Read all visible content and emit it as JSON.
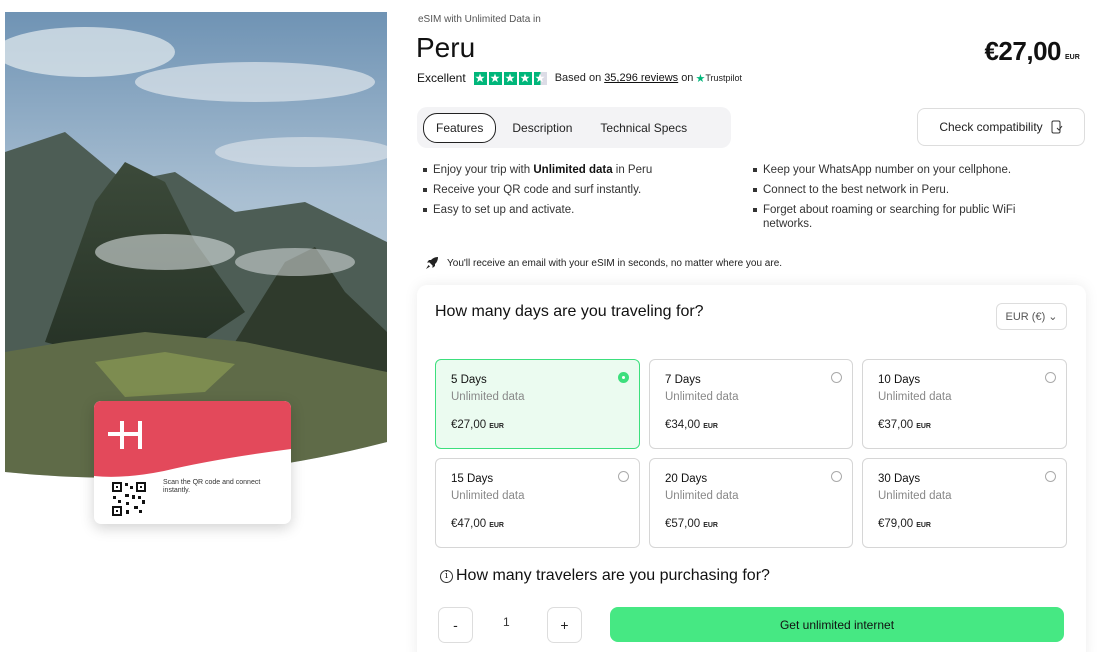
{
  "hero": {
    "card_text": "Scan the QR code and connect instantly."
  },
  "header": {
    "subtitle": "eSIM with Unlimited Data in",
    "title": "Peru",
    "price": "€27,00",
    "price_currency": "EUR"
  },
  "rating": {
    "label": "Excellent",
    "stars": 4.5,
    "based_on": "Based on",
    "reviews": "35,296 reviews",
    "on": "on",
    "provider": "Trustpilot"
  },
  "tabs": [
    {
      "label": "Features",
      "active": true
    },
    {
      "label": "Description",
      "active": false
    },
    {
      "label": "Technical Specs",
      "active": false
    }
  ],
  "compat_button": "Check compatibility",
  "features_left": {
    "f1_pre": "Enjoy your trip with ",
    "f1_bold": "Unlimited data",
    "f1_post": " in Peru",
    "f2": "Receive your QR code and surf instantly.",
    "f3": "Easy to set up and activate."
  },
  "features_right": {
    "f1": "Keep your WhatsApp number on your cellphone.",
    "f2": "Connect to the best network in Peru.",
    "f3": "Forget about roaming or searching for public WiFi networks."
  },
  "email_note": "You'll receive an email with your eSIM in seconds, no matter where you are.",
  "plan_question": "How many days are you traveling for?",
  "currency_select": "EUR (€)",
  "plans": [
    {
      "days": "5 Days",
      "data": "Unlimited data",
      "price": "€27,00",
      "cur": "EUR",
      "selected": true
    },
    {
      "days": "7 Days",
      "data": "Unlimited data",
      "price": "€34,00",
      "cur": "EUR",
      "selected": false
    },
    {
      "days": "10 Days",
      "data": "Unlimited data",
      "price": "€37,00",
      "cur": "EUR",
      "selected": false
    },
    {
      "days": "15 Days",
      "data": "Unlimited data",
      "price": "€47,00",
      "cur": "EUR",
      "selected": false
    },
    {
      "days": "20 Days",
      "data": "Unlimited data",
      "price": "€57,00",
      "cur": "EUR",
      "selected": false
    },
    {
      "days": "30 Days",
      "data": "Unlimited data",
      "price": "€79,00",
      "cur": "EUR",
      "selected": false
    }
  ],
  "travelers": {
    "question": "How many travelers are you purchasing for?",
    "minus": "-",
    "qty": "1",
    "plus": "+",
    "buy_label": "Get unlimited internet"
  },
  "colors": {
    "accent_green": "#46e883",
    "trustpilot_green": "#00b67a",
    "card_red": "#e3495b"
  }
}
